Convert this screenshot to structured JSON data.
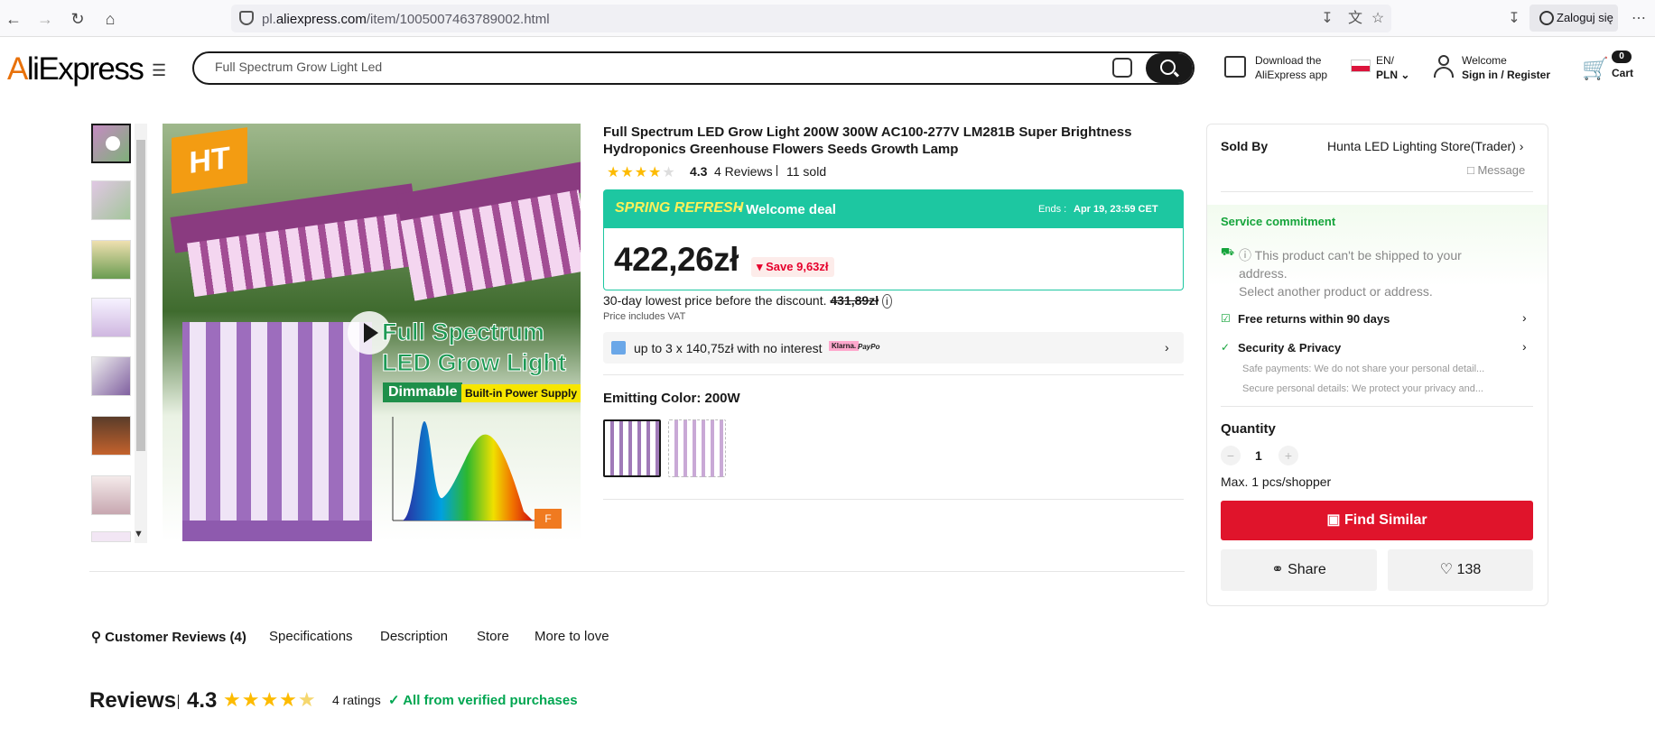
{
  "browser": {
    "url_prefix": "pl.",
    "url_domain": "aliexpress.com",
    "url_path": "/item/1005007463789002.html",
    "login_label": "Zaloguj się"
  },
  "header": {
    "logo": "AliExpress",
    "search_value": "Full Spectrum Grow Light Led",
    "app_line1": "Download the",
    "app_line2": "AliExpress app",
    "lang_line1": "EN/",
    "lang_line2": "PLN",
    "welcome": "Welcome",
    "signin": "Sign in / Register",
    "cart_count": "0",
    "cart_label": "Cart"
  },
  "image": {
    "overlay_line1": "Full Spectrum",
    "overlay_line2": "LED Grow Light",
    "dimmable": "Dimmable",
    "builtin": "Built-in Power Supply",
    "logo_text": "HT"
  },
  "product": {
    "title": "Full Spectrum LED Grow Light 200W 300W AC100-277V LM281B Super Brightness Hydroponics Greenhouse Flowers Seeds Growth Lamp",
    "rating": "4.3",
    "rating_value": 4.3,
    "reviews": "4 Reviews",
    "sold": "11 sold",
    "deal_name": "SPRING REFRESH",
    "deal_sub": "Welcome deal",
    "ends_label": "Ends :",
    "ends_value": "Apr 19, 23:59 CET",
    "price": "422,26zł",
    "save": "Save 9,63zł",
    "lowest_label": "30-day lowest price before the discount.",
    "lowest_price": "431,89zł",
    "vat": "Price includes VAT",
    "installments": "up to 3 x 140,75zł with no interest",
    "klarna": "Klarna.",
    "paypo": "PayPo",
    "color_label": "Emitting Color: 200W"
  },
  "seller": {
    "sold_by_label": "Sold By",
    "store": "Hunta LED Lighting Store(Trader)",
    "message": "Message",
    "service_title": "Service commitment",
    "ship_line1": "This product can't be shipped to your",
    "ship_line2": "address.",
    "ship_line3": "Select another product or address.",
    "returns": "Free returns within 90 days",
    "security": "Security & Privacy",
    "sec_line1": "Safe payments: We do not share your personal detail...",
    "sec_line2": "Secure personal details: We protect your privacy and...",
    "quantity_label": "Quantity",
    "quantity": "1",
    "max": "Max. 1 pcs/shopper",
    "find_similar": "Find Similar",
    "share": "Share",
    "wishlist": "138"
  },
  "tabs": [
    "Customer Reviews (4)",
    "Specifications",
    "Description",
    "Store",
    "More to love"
  ],
  "reviews": {
    "title": "Reviews",
    "score": "4.3",
    "ratings": "4 ratings",
    "verified": "All from verified purchases"
  },
  "colors": {
    "deal_green": "#1dc7a1",
    "brand_red": "#e0142b",
    "star": "#fdbb00",
    "verified_green": "#00a651"
  }
}
